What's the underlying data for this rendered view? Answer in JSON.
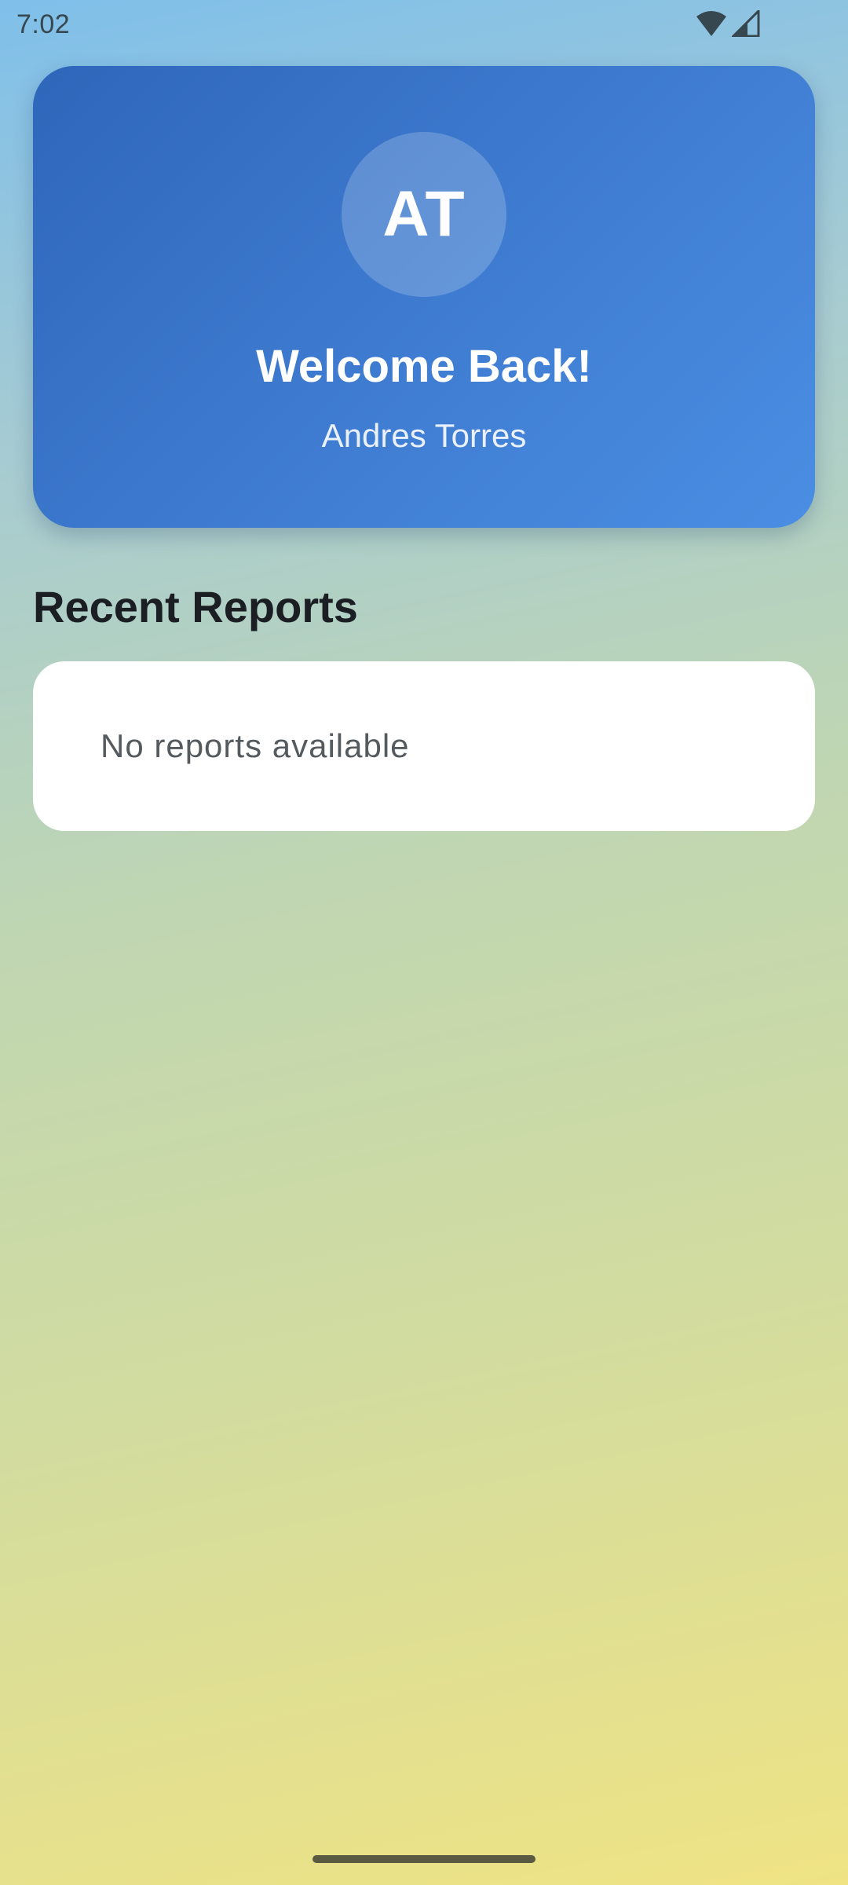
{
  "status_bar": {
    "time": "7:02",
    "icons": [
      "wifi-icon",
      "signal-icon"
    ],
    "icon_color": "#37474f"
  },
  "welcome_card": {
    "avatar_initials": "AT",
    "title": "Welcome Back!",
    "user_name": "Andres Torres",
    "gradient_colors": [
      "#2e66ba",
      "#4a8ee3"
    ]
  },
  "recent_reports": {
    "section_title": "Recent Reports",
    "empty_message": "No reports available"
  },
  "theme": {
    "background_gradient": [
      "#7fbfea",
      "#bfd6b3",
      "#efe384"
    ],
    "text_dark": "#1b1f24"
  }
}
